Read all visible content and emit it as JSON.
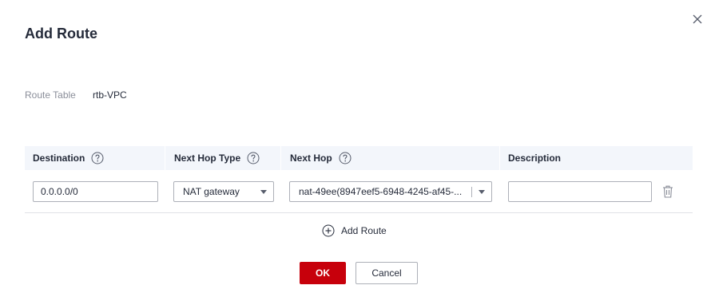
{
  "dialog": {
    "title": "Add Route",
    "close_icon": "close-icon"
  },
  "route_table": {
    "label": "Route Table",
    "value": "rtb-VPC"
  },
  "table": {
    "columns": [
      {
        "label": "Destination",
        "help_icon": "help-circle-icon"
      },
      {
        "label": "Next Hop Type",
        "help_icon": "help-circle-icon"
      },
      {
        "label": "Next Hop",
        "help_icon": "help-circle-icon"
      },
      {
        "label": "Description"
      }
    ],
    "rows": [
      {
        "destination": "0.0.0.0/0",
        "next_hop_type": "NAT gateway",
        "next_hop": "nat-49ee(8947eef5-6948-4245-af45-...",
        "description": "",
        "delete_icon": "trash-icon"
      }
    ]
  },
  "add_route": {
    "label": "Add Route",
    "icon": "plus-circle-icon"
  },
  "buttons": {
    "ok": "OK",
    "cancel": "Cancel"
  },
  "colors": {
    "primary": "#c7000b",
    "header_bg": "#f3f6fb",
    "text": "#252b3a",
    "muted": "#8a8e99",
    "border": "#adb0b8"
  }
}
